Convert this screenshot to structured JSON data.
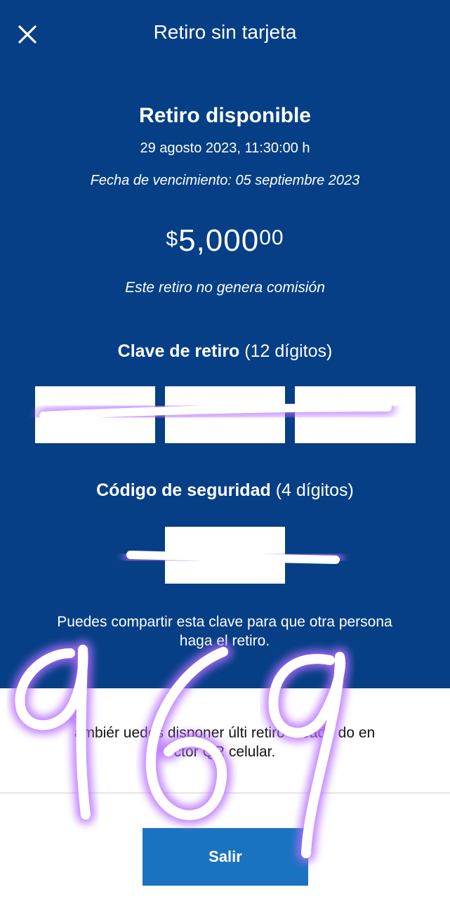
{
  "header": {
    "title": "Retiro sin tarjeta",
    "close_icon": "close-icon"
  },
  "summary": {
    "title": "Retiro disponible",
    "date": "29 agosto 2023, 11:30:00 h",
    "expiry": "Fecha de vencimiento: 05 septiembre 2023",
    "amount_currency": "$",
    "amount_whole": "5,000",
    "amount_cents": "00",
    "fee_note": "Este retiro no genera comisión"
  },
  "withdrawal_key": {
    "label_bold": "Clave de retiro",
    "label_suffix": " (12 dígitos)"
  },
  "security_code": {
    "label_bold": "Código de seguridad",
    "label_suffix": " (4 dígitos)"
  },
  "share_note": "Puedes compartir esta clave para que otra persona haga el retiro.",
  "alt_note": "ambiér uedes disponer últi retiro creado do en ctor QR celular.",
  "exit_button": "Salir",
  "handwritten_annotation": "969",
  "colors": {
    "primary_blue": "#063f85",
    "button_blue": "#1a73c0",
    "annotation_purple": "#b56cff"
  }
}
